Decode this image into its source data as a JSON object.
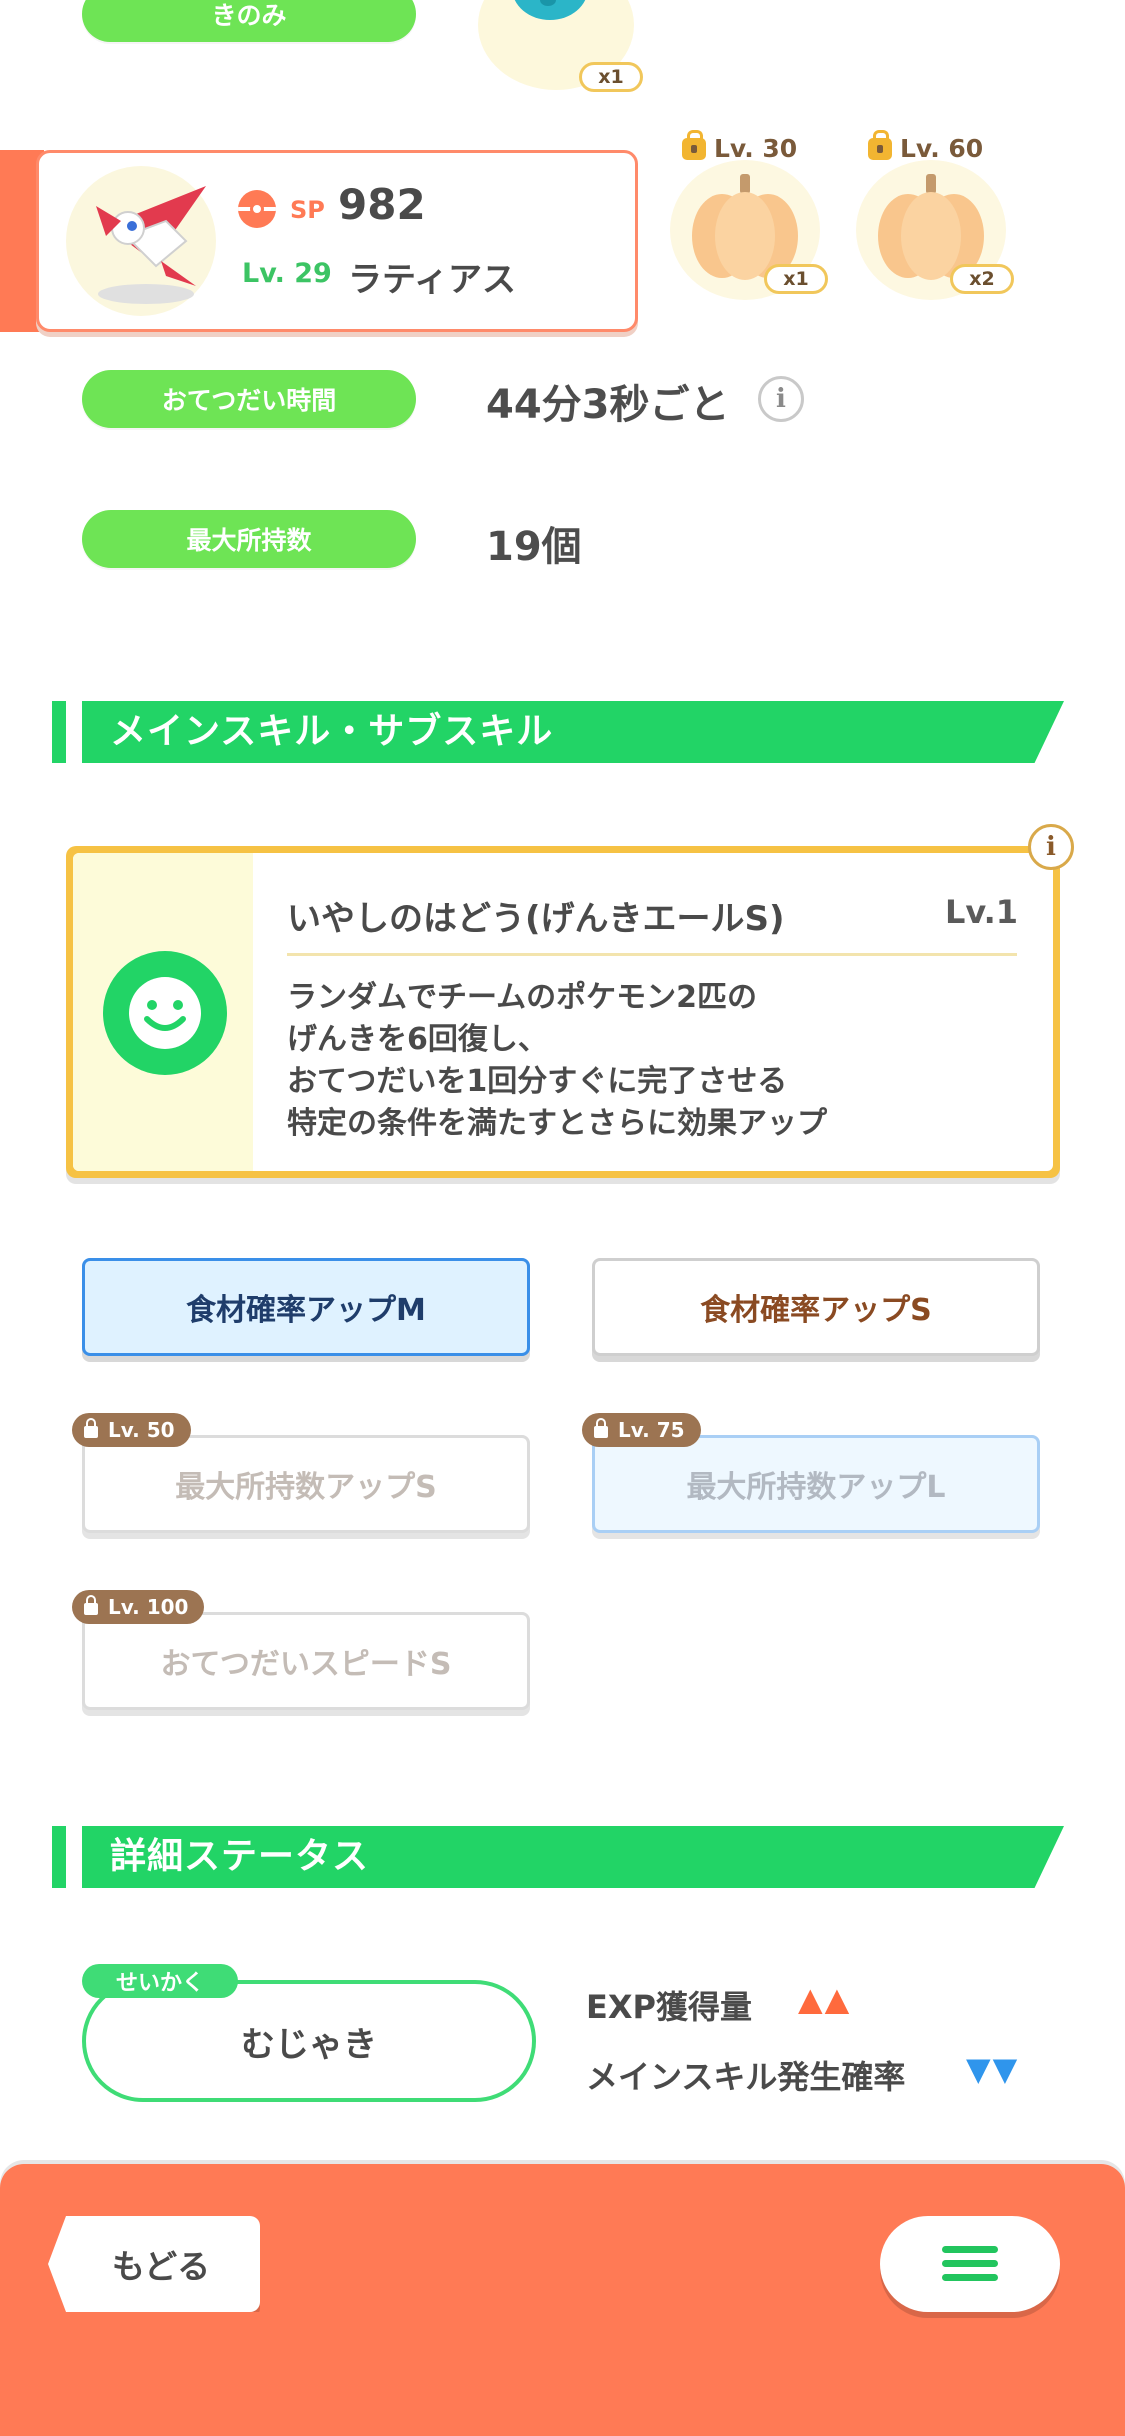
{
  "top": {
    "berry_label": "きのみ",
    "berry_badge": "x1"
  },
  "pokemon": {
    "sp_label": "SP",
    "sp_value": "982",
    "level": "Lv. 29",
    "name": "ラティアス"
  },
  "ingredients": [
    {
      "lock_level": "Lv. 30",
      "badge": "x1"
    },
    {
      "lock_level": "Lv. 60",
      "badge": "x2"
    }
  ],
  "help": {
    "time_label": "おてつだい時間",
    "time_value": "44分3秒ごと",
    "info_glyph": "i",
    "carry_label": "最大所持数",
    "carry_value": "19個"
  },
  "skills_section": {
    "title": "メインスキル・サブスキル",
    "main_skill": {
      "name": "いやしのはどう(げんきエールS)",
      "level": "Lv.1",
      "desc": [
        "ランダムでチームのポケモン2匹の",
        "げんきを6回復し、",
        "おてつだいを1回分すぐに完了させる",
        "特定の条件を満たすとさらに効果アップ"
      ],
      "info_glyph": "i"
    },
    "subskills": [
      {
        "label": "食材確率アップM",
        "lock": ""
      },
      {
        "label": "食材確率アップS",
        "lock": ""
      },
      {
        "label": "最大所持数アップS",
        "lock": "Lv. 50"
      },
      {
        "label": "最大所持数アップL",
        "lock": "Lv. 75"
      },
      {
        "label": "おてつだいスピードS",
        "lock": "Lv. 100"
      }
    ]
  },
  "details_section": {
    "title": "詳細ステータス",
    "nature_tag": "せいかく",
    "nature_value": "むじゃき",
    "stat_up_label": "EXP獲得量",
    "stat_up_marks": "▲▲",
    "stat_down_label": "メインスキル発生確率",
    "stat_down_marks": "▼▼"
  },
  "footer": {
    "back_label": "もどる",
    "colors": {
      "bar": "#ff7a55",
      "accent_green": "#22d466"
    }
  }
}
